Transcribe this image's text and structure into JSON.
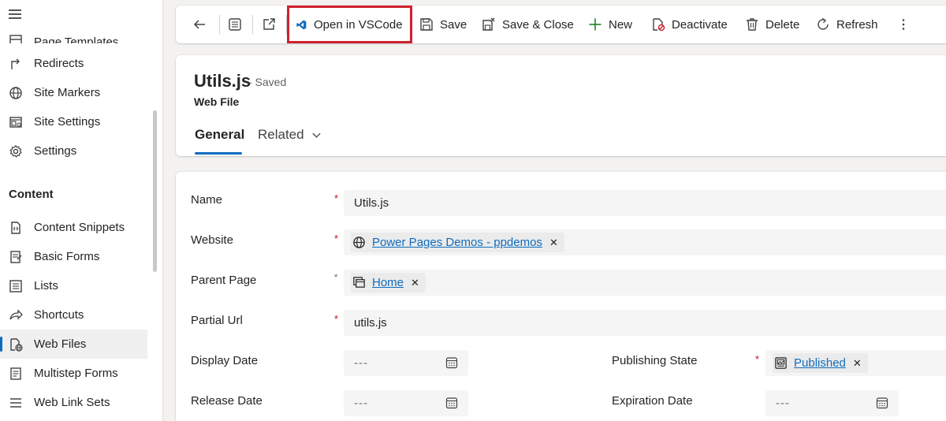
{
  "sidebar": {
    "items": [
      {
        "label": "Page Templates",
        "icon": "page-templates-icon"
      },
      {
        "label": "Redirects",
        "icon": "redirect-icon"
      },
      {
        "label": "Site Markers",
        "icon": "globe-icon"
      },
      {
        "label": "Site Settings",
        "icon": "site-settings-icon"
      },
      {
        "label": "Settings",
        "icon": "gear-icon"
      }
    ],
    "section": "Content",
    "content_items": [
      {
        "label": "Content Snippets",
        "icon": "snippet-icon"
      },
      {
        "label": "Basic Forms",
        "icon": "form-icon"
      },
      {
        "label": "Lists",
        "icon": "list-icon"
      },
      {
        "label": "Shortcuts",
        "icon": "shortcut-icon"
      },
      {
        "label": "Web Files",
        "icon": "web-file-icon",
        "active": true
      },
      {
        "label": "Multistep Forms",
        "icon": "multistep-form-icon"
      },
      {
        "label": "Web Link Sets",
        "icon": "link-set-icon"
      }
    ]
  },
  "toolbar": {
    "open_vscode": "Open in VSCode",
    "save": "Save",
    "save_close": "Save & Close",
    "new": "New",
    "deactivate": "Deactivate",
    "delete": "Delete",
    "refresh": "Refresh"
  },
  "record": {
    "title": "Utils.js",
    "status": "- Saved",
    "type": "Web File"
  },
  "tabs": [
    {
      "label": "General",
      "active": true
    },
    {
      "label": "Related",
      "active": false
    }
  ],
  "form": {
    "name_label": "Name",
    "name_value": "Utils.js",
    "website_label": "Website",
    "website_value": "Power Pages Demos - ppdemos",
    "parent_page_label": "Parent Page",
    "parent_page_value": "Home",
    "partial_url_label": "Partial Url",
    "partial_url_value": "utils.js",
    "display_date_label": "Display Date",
    "display_date_value": "---",
    "release_date_label": "Release Date",
    "release_date_value": "---",
    "publishing_state_label": "Publishing State",
    "publishing_state_value": "Published",
    "expiration_date_label": "Expiration Date",
    "expiration_date_value": "---",
    "required_marker": "*",
    "remove_marker": "✕"
  },
  "colors": {
    "accent": "#0f6cbd",
    "highlight_box": "#d0202e",
    "required": "#c50f1f"
  }
}
